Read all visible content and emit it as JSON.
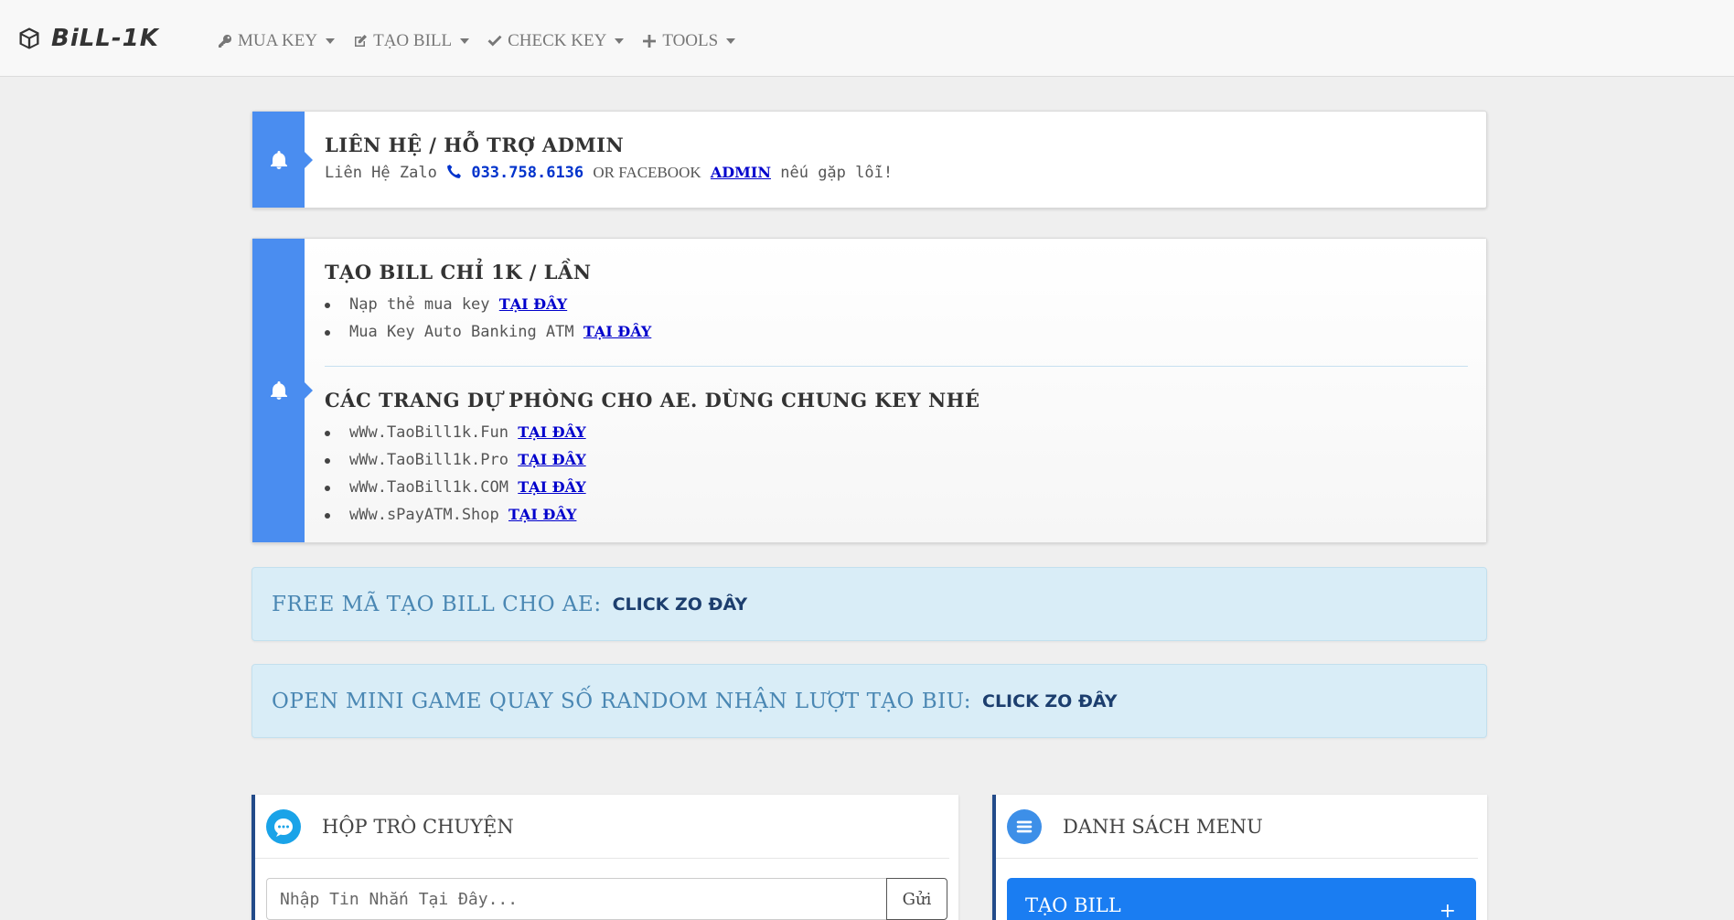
{
  "navbar": {
    "brand": "BiLL-1K",
    "items": [
      {
        "label": "MUA KEY",
        "icon": "key-icon"
      },
      {
        "label": "TẠO BILL",
        "icon": "edit-icon"
      },
      {
        "label": "CHECK KEY",
        "icon": "check-icon"
      },
      {
        "label": "TOOLS",
        "icon": "plus-icon"
      }
    ]
  },
  "contact": {
    "title": "LIÊN HỆ / HỖ TRỢ ADMIN",
    "prefix": "Liên Hệ Zalo",
    "phone": "033.758.6136",
    "middle": "OR FACEBOOK",
    "admin_link": "ADMIN",
    "suffix": "nếu gặp lỗi!"
  },
  "promo": {
    "title": "TẠO BILL CHỈ 1K / LẦN",
    "items": [
      {
        "text": "Nạp thẻ mua key",
        "link": "TẠI ĐÂY"
      },
      {
        "text": "Mua Key Auto Banking ATM",
        "link": "TẠI ĐÂY"
      }
    ],
    "backup_title": "CÁC TRANG DỰ PHÒNG CHO AE. DÙNG CHUNG KEY NHÉ",
    "backup_items": [
      {
        "text": "wWw.TaoBill1k.Fun",
        "link": "TẠI ĐÂY"
      },
      {
        "text": "wWw.TaoBill1k.Pro",
        "link": "TẠI ĐÂY"
      },
      {
        "text": "wWw.TaoBill1k.COM",
        "link": "TẠI ĐÂY"
      },
      {
        "text": "wWw.sPayATM.Shop",
        "link": "TẠI ĐÂY"
      }
    ]
  },
  "bars": {
    "free": {
      "label": "FREE MÃ TẠO BILL CHO AE:",
      "cta": "CLICK ZO ĐÂY"
    },
    "game": {
      "label": "OPEN MINI GAME QUAY SỐ RANDOM NHẬN LƯỢT TẠO BIU:",
      "cta": "CLICK ZO ĐÂY"
    }
  },
  "chat": {
    "title": "HỘP TRÒ CHUYỆN",
    "placeholder": "Nhập Tin Nhắn Tại Đây...",
    "send": "Gửi"
  },
  "menu": {
    "title": "DANH SÁCH MENU",
    "first_item": "TẠO BILL",
    "expand": "+"
  },
  "colors": {
    "accent_blue": "#4a8df0",
    "info_bg": "#d9edf7",
    "menu_button": "#1a7df2",
    "link": "#0000cc"
  }
}
